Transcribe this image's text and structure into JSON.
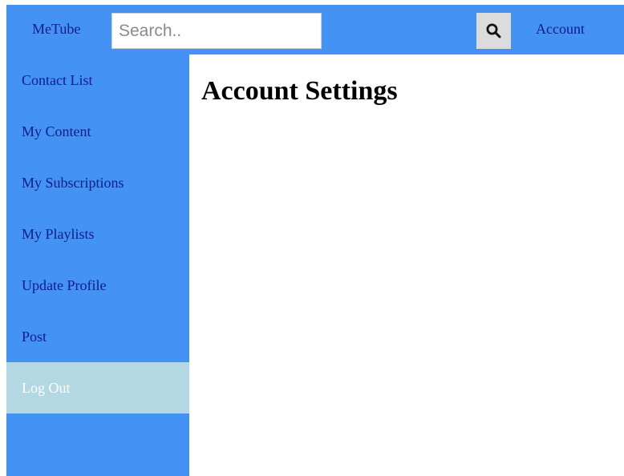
{
  "header": {
    "brand": "MeTube",
    "search": {
      "placeholder": "Search..",
      "value": ""
    },
    "search_icon": "magnifier-icon",
    "account_label": "Account"
  },
  "sidebar": {
    "items": [
      {
        "label": "Contact List"
      },
      {
        "label": "My Content"
      },
      {
        "label": "My Subscriptions"
      },
      {
        "label": "My Playlists"
      },
      {
        "label": "Update Profile"
      },
      {
        "label": "Post"
      },
      {
        "label": "Log Out",
        "active": true
      }
    ]
  },
  "main": {
    "title": "Account Settings"
  },
  "colors": {
    "nav_blue": "#4592f5",
    "link_text": "#0b1d87",
    "active_item_bg": "#b3d8e4",
    "active_item_text": "#ffffff",
    "search_button_bg": "#dcdcdc"
  }
}
